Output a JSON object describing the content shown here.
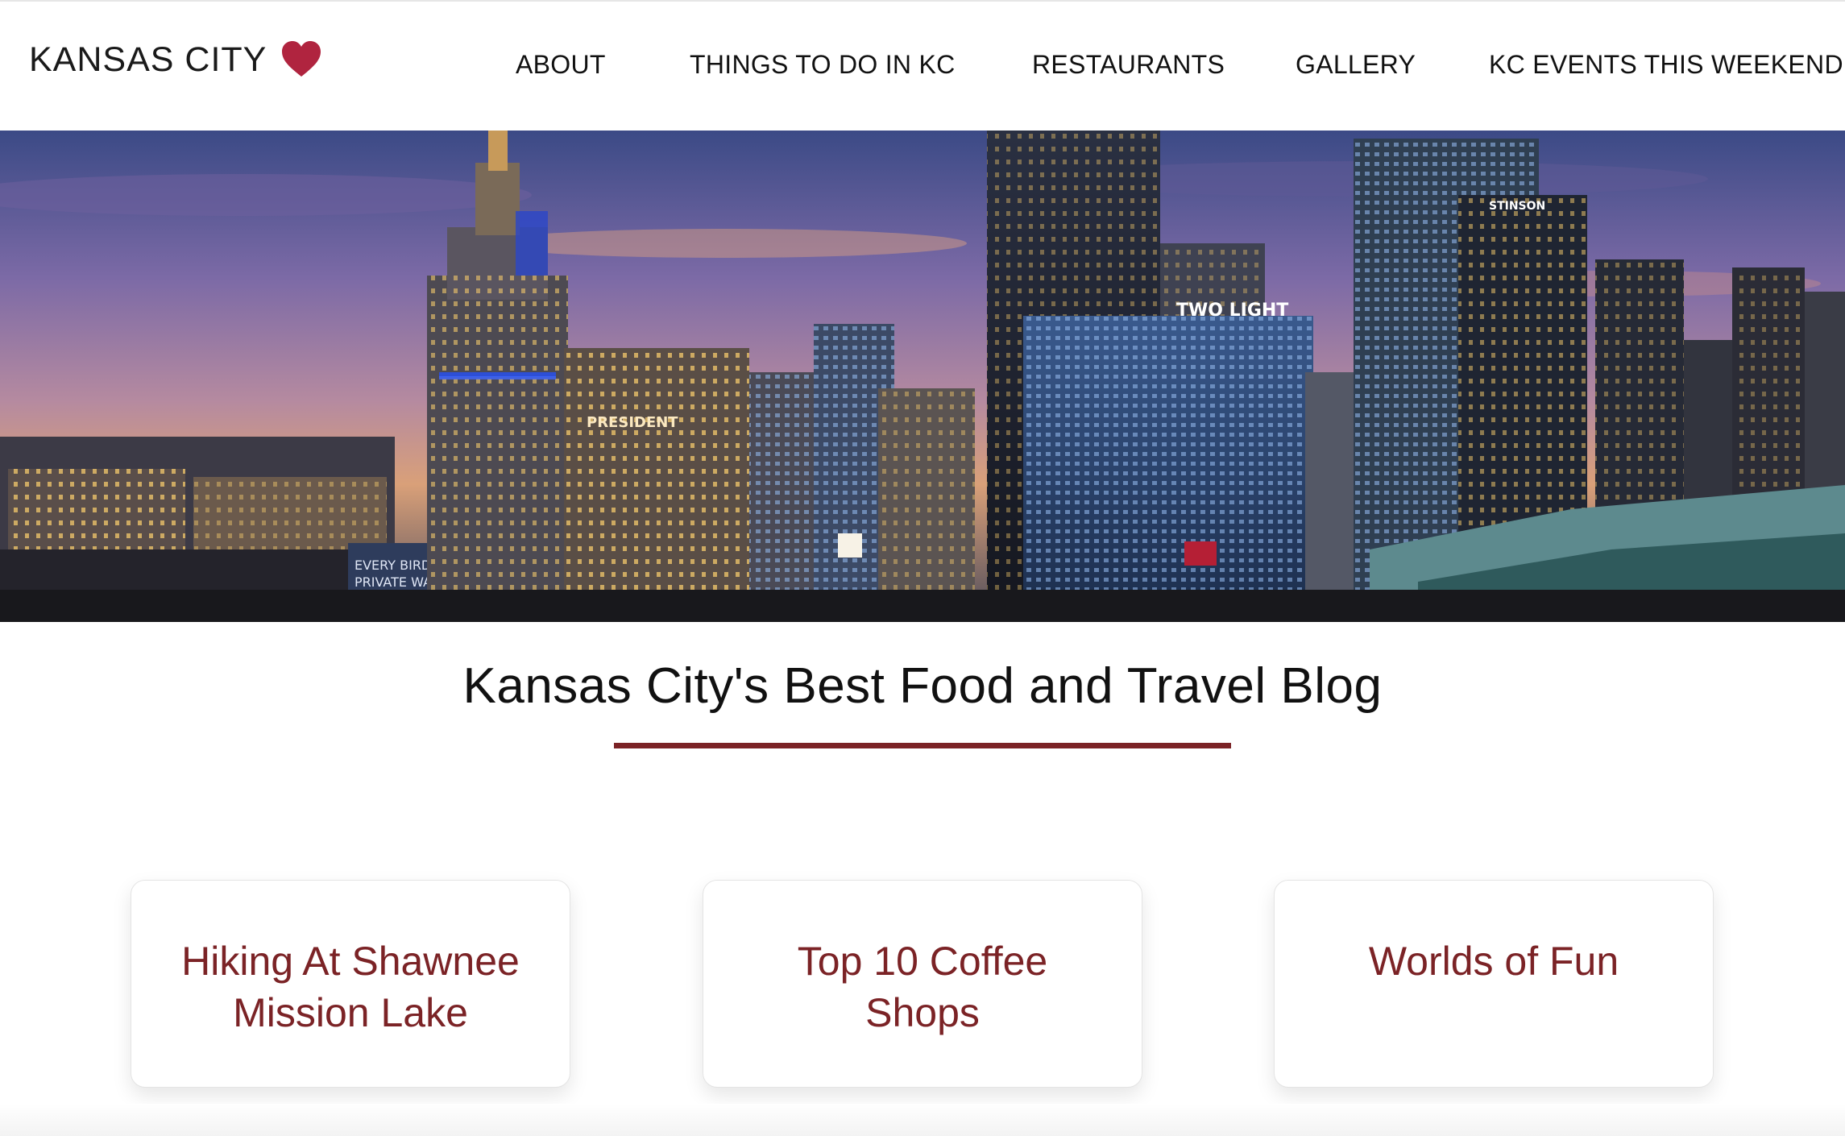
{
  "header": {
    "logo_text": "KANSAS CITY",
    "logo_icon": "heart-icon",
    "nav": [
      {
        "label": "ABOUT"
      },
      {
        "label": "THINGS TO DO IN KC"
      },
      {
        "label": "RESTAURANTS"
      },
      {
        "label": "GALLERY"
      },
      {
        "label": "KC EVENTS THIS WEEKEND"
      }
    ]
  },
  "hero": {
    "signs": [
      "TWO LIGHT",
      "PRESIDENT",
      "STINSON",
      "EVERY BIRD THAT",
      "PRIVATE WAREHO"
    ]
  },
  "main": {
    "title": "Kansas City's Best Food and Travel Blog",
    "cards": [
      {
        "title": "Hiking At Shawnee Mission Lake"
      },
      {
        "title": "Top 10 Coffee Shops"
      },
      {
        "title": "Worlds of Fun"
      }
    ]
  },
  "colors": {
    "accent": "#7b2326",
    "heart": "#b0243f",
    "text": "#111111"
  }
}
